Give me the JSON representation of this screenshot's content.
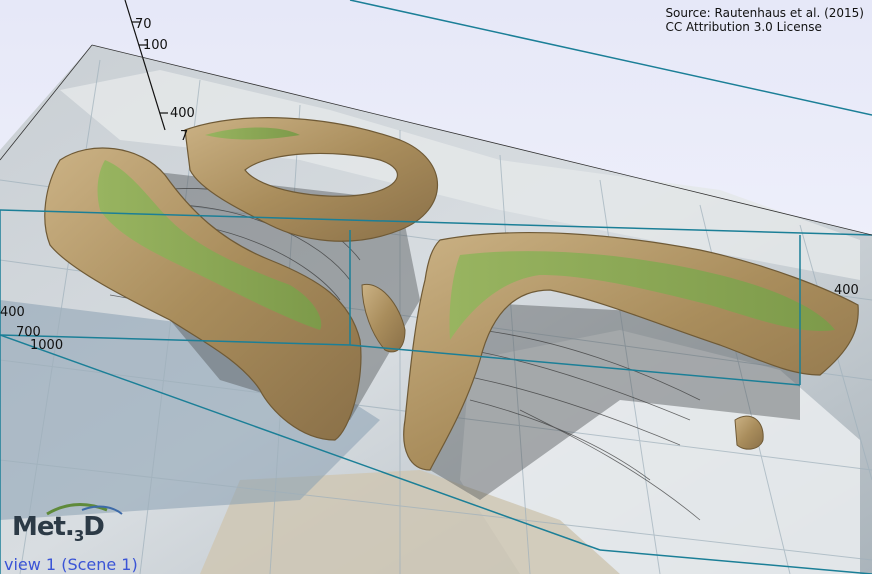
{
  "credits": {
    "line1": "Source: Rautenhaus et al. (2015)",
    "line2": "CC Attribution 3.0 License"
  },
  "axis_ticks": {
    "top": [
      "70",
      "100"
    ],
    "upper_left": [
      "400",
      "7"
    ],
    "left": [
      "400",
      "700",
      "1000"
    ],
    "right": [
      "400"
    ]
  },
  "logo": {
    "text_main": "Met.",
    "text_sub": "3",
    "text_end": "D"
  },
  "view": {
    "label": "view 1 (Scene 1)"
  },
  "colors": {
    "isosurface": "#b59a68",
    "isosurface_inner": "#8fa85a",
    "bounding_box": "#1b7f97",
    "background": "#eef0fb"
  }
}
